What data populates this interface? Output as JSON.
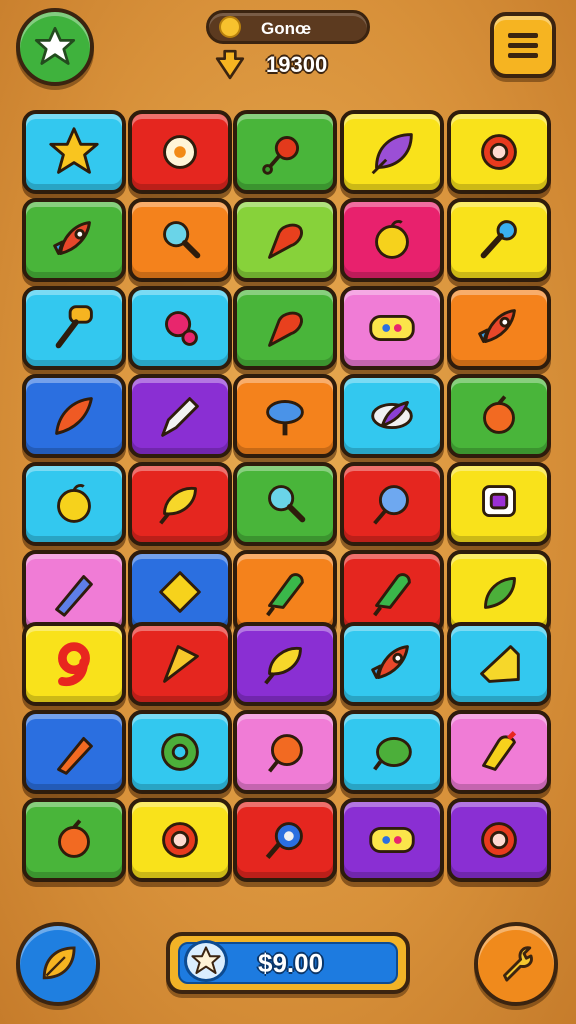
{
  "header": {
    "title": "Gonœ",
    "score": "19300"
  },
  "footer": {
    "currency": "$9.00"
  },
  "colors": {
    "cyan": "#33c8ef",
    "red": "#e5261f",
    "green": "#49b53a",
    "yellow": "#f9e21b",
    "orange": "#f4821c",
    "pink": "#f07cd6",
    "purple": "#8a2fd3",
    "blue": "#2b6fe0",
    "lime": "#87d23a",
    "magenta": "#e8216d"
  },
  "board_top": [
    [
      "cyan:star-icon",
      "red:flower-icon",
      "green:bug-icon",
      "yellow:leaf-icon",
      "yellow:ring-icon"
    ],
    [
      "green:rocket-icon",
      "orange:magnifier-icon",
      "lime:carrot-icon",
      "magenta:apple-icon",
      "yellow:shovel-icon"
    ],
    [
      "cyan:mallet-icon",
      "cyan:candy-icon",
      "green:carrot-icon",
      "pink:bandage-icon",
      "orange:rocket-icon"
    ],
    [
      "blue:feather-icon",
      "purple:pencil-icon",
      "orange:top-icon",
      "cyan:fish-icon",
      "green:bell-icon"
    ],
    [
      "cyan:apple-icon",
      "red:lemon-icon",
      "green:magnifier-icon",
      "red:kite-icon",
      "yellow:frame-icon"
    ],
    [
      "pink:crayon-icon",
      "blue:diamond-icon",
      "orange:popsicle-icon",
      "red:popsicle-icon",
      "yellow:pepper-icon"
    ]
  ],
  "board_bottom": [
    [
      "yellow:nine-icon",
      "red:pizza-icon",
      "purple:lemon-icon",
      "cyan:rocket-icon",
      "cyan:cheese-icon"
    ],
    [
      "blue:marker-icon",
      "cyan:donut-icon",
      "pink:peach-icon",
      "cyan:melon-icon",
      "pink:lamp-icon"
    ],
    [
      "green:bell-icon",
      "yellow:ring-icon",
      "red:key-icon",
      "purple:bandage-icon",
      "purple:ring-icon"
    ]
  ]
}
